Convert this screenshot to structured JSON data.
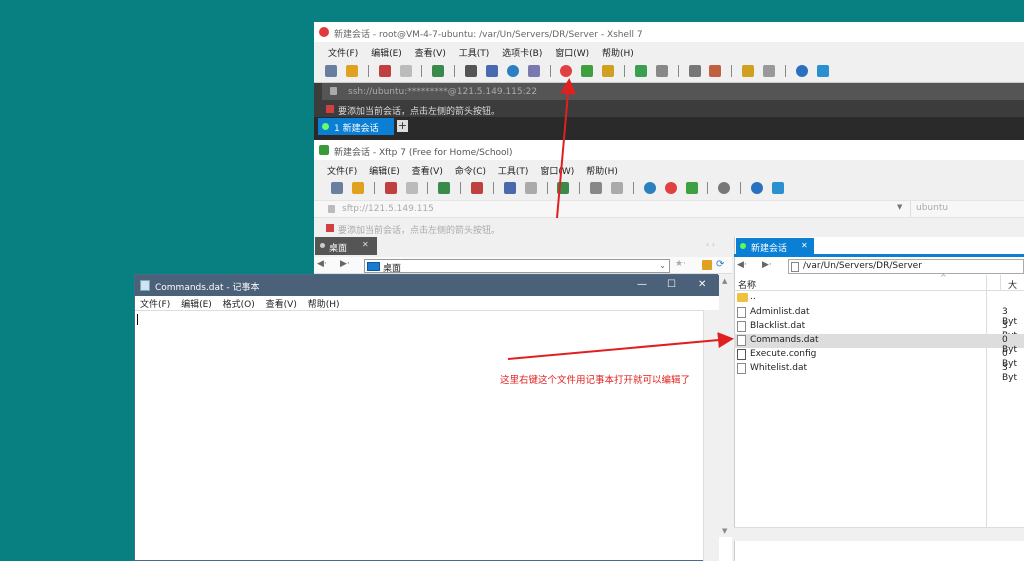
{
  "xshell": {
    "title": "新建会话 - root@VM-4-7-ubuntu: /var/Un/Servers/DR/Server - Xshell 7",
    "menu": [
      "文件(F)",
      "编辑(E)",
      "查看(V)",
      "工具(T)",
      "选项卡(B)",
      "窗口(W)",
      "帮助(H)"
    ],
    "address": "ssh://ubuntu:*********@121.5.149.115:22",
    "hint": "要添加当前会话，点击左侧的箭头按钮。",
    "tab": "1 新建会话",
    "plus": "+"
  },
  "xftp": {
    "title": "新建会话 - Xftp 7 (Free for Home/School)",
    "menu": [
      "文件(F)",
      "编辑(E)",
      "查看(V)",
      "命令(C)",
      "工具(T)",
      "窗口(W)",
      "帮助(H)"
    ],
    "address": "sftp://121.5.149.115",
    "user": "ubuntu",
    "hint": "要添加当前会话，点击左侧的箭头按钮。",
    "left_tab": "桌面",
    "left_path": "桌面",
    "right_tab": "新建会话",
    "right_path": "/var/Un/Servers/DR/Server",
    "col_name": "名称",
    "col_size": "大",
    "files": [
      {
        "name": "..",
        "size": ""
      },
      {
        "name": "Adminlist.dat",
        "size": "3 Byt"
      },
      {
        "name": "Blacklist.dat",
        "size": "3 Byt"
      },
      {
        "name": "Commands.dat",
        "size": "0 Byt"
      },
      {
        "name": "Execute.config",
        "size": "0 Byt"
      },
      {
        "name": "Whitelist.dat",
        "size": "3 Byt"
      }
    ]
  },
  "notepad": {
    "title": "Commands.dat - 记事本",
    "menu": [
      "文件(F)",
      "编辑(E)",
      "格式(O)",
      "查看(V)",
      "帮助(H)"
    ],
    "content": ""
  },
  "annotation": "这里右键这个文件用记事本打开就可以编辑了",
  "colors": {
    "accent": "#0a7fd4",
    "arrow": "#e02020",
    "desktop": "#087f80"
  }
}
